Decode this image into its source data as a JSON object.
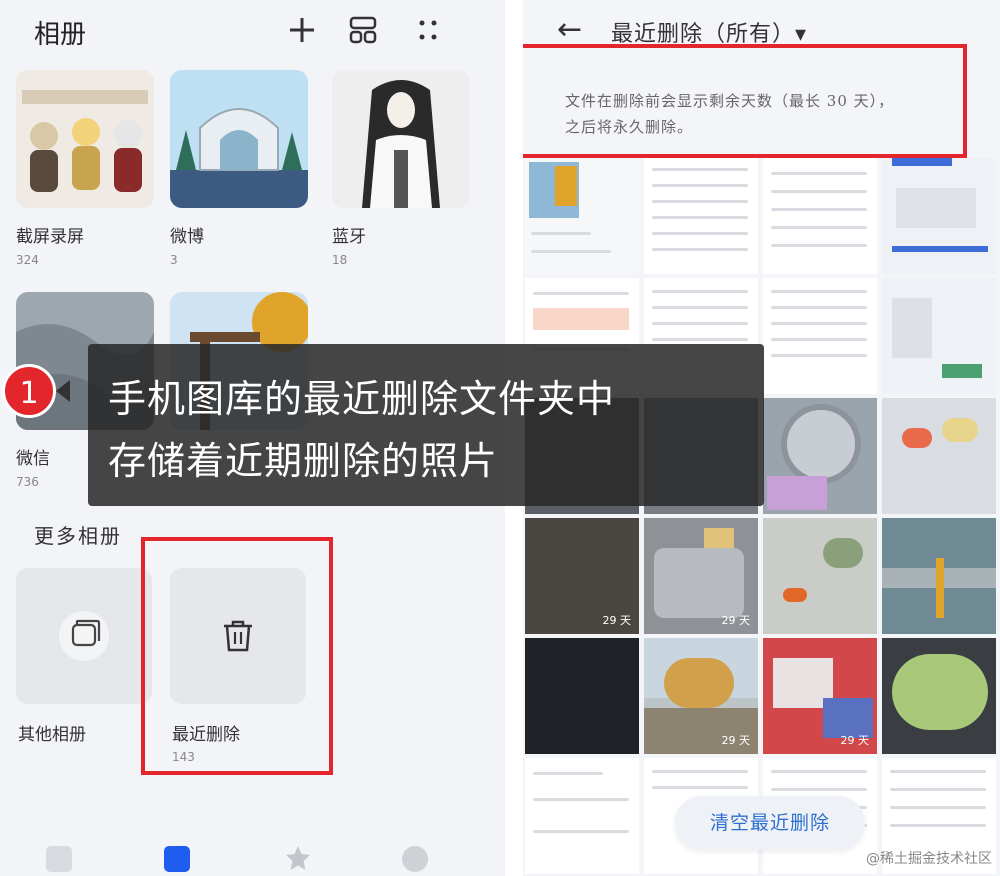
{
  "left": {
    "title": "相册",
    "icons": [
      "plus-icon",
      "layout-icon",
      "more-dots-icon"
    ],
    "albums": [
      {
        "name": "截屏录屏",
        "count": "324"
      },
      {
        "name": "微博",
        "count": "3"
      },
      {
        "name": "蓝牙",
        "count": "18"
      },
      {
        "name": "微信",
        "count": "736"
      }
    ],
    "more_section": "更多相册",
    "more_albums": [
      {
        "name": "其他相册",
        "count": ""
      },
      {
        "name": "最近删除",
        "count": "143"
      }
    ]
  },
  "overlay": {
    "badge": "1",
    "line1": "手机图库的最近删除文件夹中",
    "line2": "存储着近期删除的照片"
  },
  "right": {
    "back_icon": "←",
    "title": "最近删除（所有）▾",
    "note_line1": "文件在删除前会显示剩余天数（最长 30 天），",
    "note_line2": "之后将永久删除。",
    "days_label": "29 天",
    "clear_button": "清空最近删除"
  },
  "watermark": "@稀土掘金技术社区",
  "colors": {
    "accent_red": "#e3262b",
    "link_blue": "#2f6fd0"
  }
}
